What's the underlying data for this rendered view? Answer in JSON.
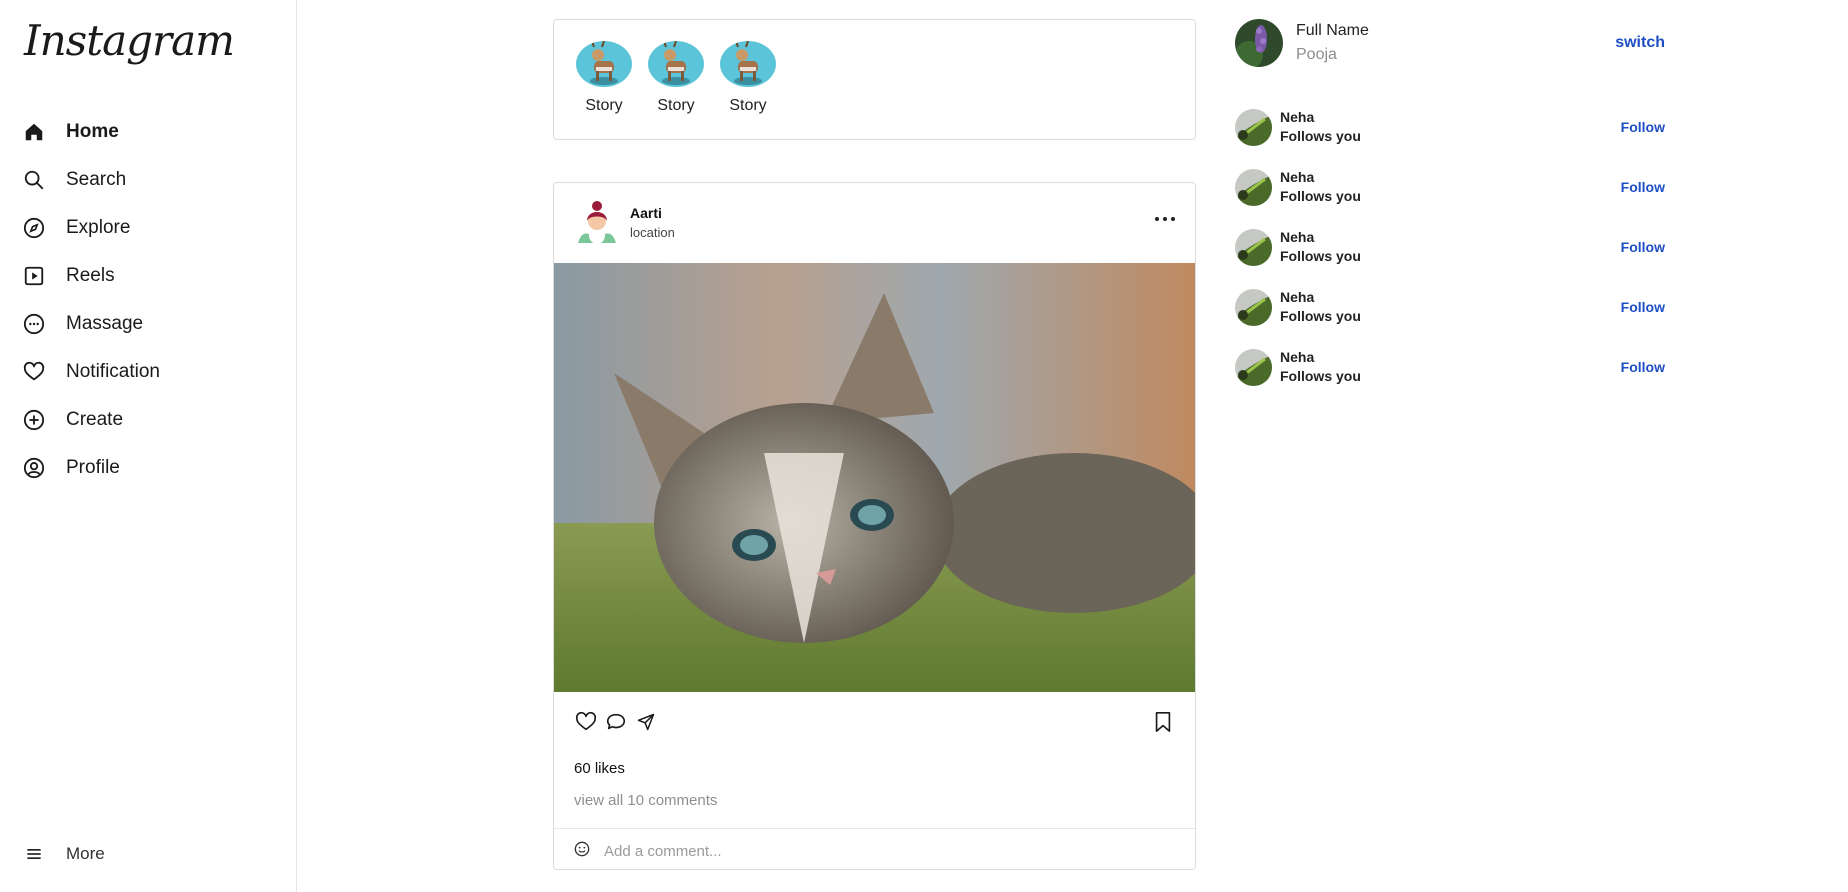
{
  "brand": {
    "logo_text": "Instagram"
  },
  "sidebar": {
    "items": [
      {
        "label": "Home",
        "icon": "home-icon",
        "active": true
      },
      {
        "label": "Search",
        "icon": "search-icon"
      },
      {
        "label": "Explore",
        "icon": "compass-icon"
      },
      {
        "label": "Reels",
        "icon": "reels-icon"
      },
      {
        "label": "Massage",
        "icon": "message-icon"
      },
      {
        "label": "Notification",
        "icon": "heart-icon"
      },
      {
        "label": "Create",
        "icon": "plus-circle-icon"
      },
      {
        "label": "Profile",
        "icon": "user-circle-icon"
      }
    ],
    "more_label": "More"
  },
  "stories": [
    {
      "label": "Story"
    },
    {
      "label": "Story"
    },
    {
      "label": "Story"
    }
  ],
  "post": {
    "username": "Aarti",
    "location": "location",
    "likes": "60 likes",
    "view_comments": "view all 10 comments",
    "comment_placeholder": "Add a comment..."
  },
  "current_user": {
    "full_name": "Full Name",
    "username": "Pooja",
    "switch_label": "switch"
  },
  "suggestions": [
    {
      "name": "Neha",
      "subtitle": "Follows you",
      "action": "Follow"
    },
    {
      "name": "Neha",
      "subtitle": "Follows you",
      "action": "Follow"
    },
    {
      "name": "Neha",
      "subtitle": "Follows you",
      "action": "Follow"
    },
    {
      "name": "Neha",
      "subtitle": "Follows you",
      "action": "Follow"
    },
    {
      "name": "Neha",
      "subtitle": "Follows you",
      "action": "Follow"
    }
  ],
  "colors": {
    "link": "#1f4fc5",
    "story_ring": "#5bc4d8",
    "border": "#dbdbdb"
  }
}
